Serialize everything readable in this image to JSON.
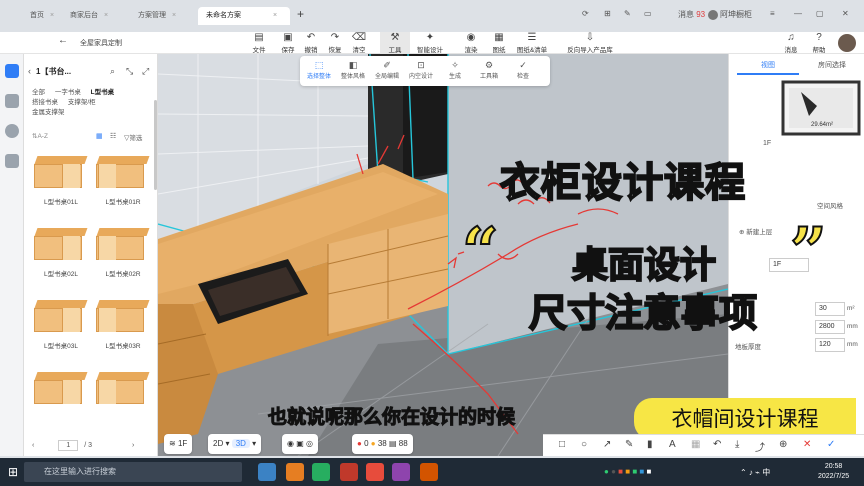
{
  "browser": {
    "tabs": [
      {
        "label": "首页",
        "active": false
      },
      {
        "label": "商家后台",
        "active": false
      },
      {
        "label": "方案管理",
        "active": false
      },
      {
        "label": "未命名方案",
        "active": true
      }
    ],
    "new_tab": "+",
    "messages_label": "消息",
    "messages_count": "93",
    "user_name": "阿坤橱柜"
  },
  "toolbar": {
    "breadcrumb": "全屋家具定制",
    "buttons": [
      {
        "label": "文件",
        "icon": "folder-icon"
      },
      {
        "label": "保存",
        "icon": "save-icon"
      },
      {
        "label": "撤销",
        "icon": "undo-icon"
      },
      {
        "label": "恢复",
        "icon": "redo-icon"
      },
      {
        "label": "清空",
        "icon": "clear-icon"
      },
      {
        "label": "工具",
        "icon": "tools-icon"
      },
      {
        "label": "智能设计",
        "icon": "magic-icon"
      },
      {
        "label": "渲染",
        "icon": "camera-icon"
      },
      {
        "label": "图纸",
        "icon": "drawing-icon"
      },
      {
        "label": "图纸&清单",
        "icon": "list-icon"
      },
      {
        "label": "反向导入产品库",
        "icon": "import-icon"
      },
      {
        "label": "消息",
        "icon": "bell-icon"
      },
      {
        "label": "帮助",
        "icon": "help-icon"
      }
    ]
  },
  "subtoolbar": {
    "items": [
      {
        "label": "选择整体",
        "active": true
      },
      {
        "label": "整体风格",
        "active": false
      },
      {
        "label": "全局编辑",
        "active": false
      },
      {
        "label": "内空设计",
        "active": false
      },
      {
        "label": "生成",
        "active": false
      },
      {
        "label": "工具箱",
        "active": false
      },
      {
        "label": "检查",
        "active": false
      }
    ]
  },
  "left_panel": {
    "title": "1【书台...",
    "categories": [
      {
        "label": "全部",
        "active": false
      },
      {
        "label": "一字书桌",
        "active": false
      },
      {
        "label": "L型书桌",
        "active": true
      },
      {
        "label": "搭接书桌",
        "active": false
      },
      {
        "label": "支撑架/柜",
        "active": false
      },
      {
        "label": "金属支撑架",
        "active": false
      }
    ],
    "sort_label": "A-Z",
    "filter_label": "筛选",
    "items": [
      "L型书桌01L",
      "L型书桌01R",
      "L型书桌02L",
      "L型书桌02R",
      "L型书桌03L",
      "L型书桌03R",
      "",
      ""
    ],
    "page_current": "1",
    "page_total": "/ 3"
  },
  "right_panel": {
    "tabs": [
      {
        "label": "视图",
        "active": true
      },
      {
        "label": "房间选择",
        "active": false
      }
    ],
    "room_area": "29.64m²",
    "floor": "1F",
    "style_label": "空间风格",
    "new_floor_label": "新建上层",
    "floor_input": "1F",
    "rows": [
      {
        "label": "",
        "value": "30",
        "unit": "m²"
      },
      {
        "label": "",
        "value": "2800",
        "unit": "mm"
      },
      {
        "label": "地板厚度",
        "value": "120",
        "unit": "mm"
      }
    ]
  },
  "bottom_bar": {
    "floor": "1F",
    "view_2d": "2D",
    "view_3d": "3D",
    "error_count": "0",
    "warn_count": "38",
    "item_count": "88"
  },
  "overlay": {
    "title": "衣柜设计课程",
    "quote_open": "“",
    "quote_close": "”",
    "line1": "桌面设计",
    "line2": "尺寸注意事项",
    "subtitle": "也就说呢那么你在设计的时候",
    "ribbon": "衣帽间设计课程"
  },
  "taskbar": {
    "search_placeholder": "在这里输入进行搜索",
    "time": "20:58",
    "date": "2022/7/25"
  },
  "colors": {
    "accent": "#2f7df6",
    "wood": "#e8a95a",
    "overlay_yellow": "#f6e24a",
    "ribbon_yellow": "#f7e645"
  }
}
